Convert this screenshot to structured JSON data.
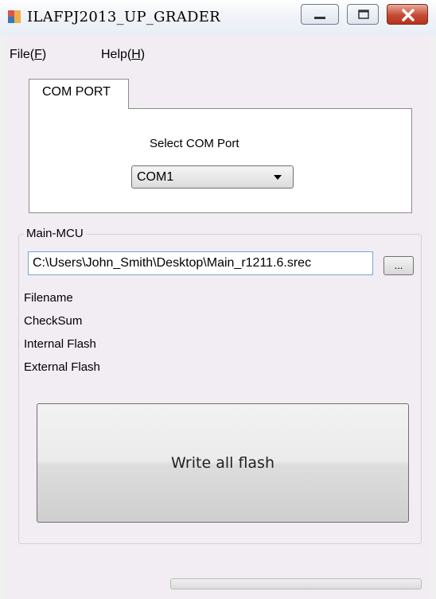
{
  "window": {
    "title": "ILAFPJ2013_UP_GRADER",
    "icon": "app-window-icon"
  },
  "menu": {
    "file": {
      "label": "File(",
      "mnemonic": "F",
      "tail": ")"
    },
    "help": {
      "label": "Help(",
      "mnemonic": "H",
      "tail": ")"
    }
  },
  "com_tab": {
    "tab_label": "COM PORT",
    "select_label": "Select COM Port",
    "selected_port": "COM1"
  },
  "main_mcu": {
    "group_label": "Main-MCU",
    "file_path": "C:\\Users\\John_Smith\\Desktop\\Main_r1211.6.srec",
    "browse_label": "...",
    "info_labels": [
      "Filename",
      "CheckSum",
      "Internal Flash",
      "External Flash"
    ],
    "write_button_label": "Write all flash"
  },
  "progress": {
    "value": 0
  }
}
